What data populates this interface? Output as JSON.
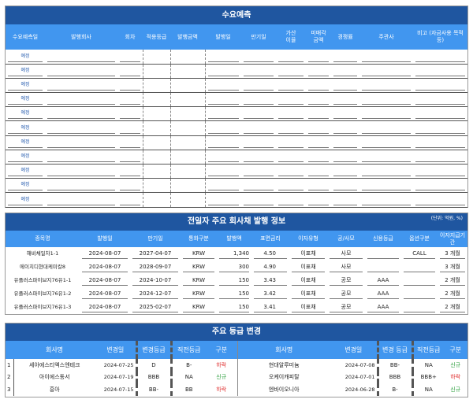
{
  "forecast": {
    "title": "수요예측",
    "headers": [
      "수요예측일",
      "발행회사",
      "회차",
      "적용등급",
      "발행금액",
      "발행일",
      "만기일",
      "가산\n이율",
      "미매각\n금액",
      "경쟁률",
      "주관사",
      "비고 (자금사용 목적 등)"
    ],
    "rows": [
      "예정",
      "예정",
      "예정",
      "예정",
      "예정",
      "예정",
      "예정",
      "예정",
      "예정",
      "예정",
      "예정"
    ]
  },
  "issuance": {
    "title": "전일자 주요 회사채 발행 정보",
    "unit": "(단위: 억원, %)",
    "headers": [
      "종목명",
      "발행일",
      "만기일",
      "통화구분",
      "발행액",
      "표면금리",
      "이자유형",
      "공/사모",
      "신용등급",
      "옵션구분",
      "이자지급기간"
    ],
    "rows": [
      [
        "해비채일차1-1",
        "2024-08-07",
        "2027-04-07",
        "KRW",
        "1,340",
        "4.50",
        "이표채",
        "사모",
        "",
        "CALL",
        "3 개월"
      ],
      [
        "에이치디현대케미칼8",
        "2024-08-07",
        "2028-09-07",
        "KRW",
        "300",
        "4.90",
        "이표채",
        "사모",
        "",
        "",
        "3 개월"
      ],
      [
        "유플러스파이브지76유1-1",
        "2024-08-07",
        "2024-10-07",
        "KRW",
        "150",
        "3.43",
        "이표채",
        "공모",
        "AAA",
        "",
        "2 개월"
      ],
      [
        "유플러스파이브지76유1-2",
        "2024-08-07",
        "2024-12-07",
        "KRW",
        "150",
        "3.42",
        "이표채",
        "공모",
        "AAA",
        "",
        "2 개월"
      ],
      [
        "유플러스파이브지76유1-3",
        "2024-08-07",
        "2025-02-07",
        "KRW",
        "150",
        "3.41",
        "이표채",
        "공모",
        "AAA",
        "",
        "2 개월"
      ]
    ]
  },
  "ratings": {
    "title": "주요 등급 변경",
    "headers_left": [
      "회사명",
      "변경일",
      "변경등급",
      "직전등급",
      "구분"
    ],
    "headers_right": [
      "회사명",
      "변경일",
      "변경 등급",
      "직전등급",
      "구분"
    ],
    "rows": [
      {
        "idx": "1",
        "l": [
          "세아에스티엑스엔테크",
          "2024-07-25",
          "D",
          "B-",
          "하락"
        ],
        "r": [
          "현대알루미늄",
          "2024-07-08",
          "BB-",
          "NA",
          "신규"
        ]
      },
      {
        "idx": "2",
        "l": [
          "아이에스동서",
          "2024-07-19",
          "BBB",
          "NA",
          "신규"
        ],
        "r": [
          "오케이캐피탈",
          "2024-07-01",
          "BBB",
          "BBB+",
          "하락"
        ]
      },
      {
        "idx": "3",
        "l": [
          "흥아",
          "2024-07-15",
          "BB-",
          "BB",
          "하락"
        ],
        "r": [
          "엔바이오니아",
          "2024-06-28",
          "B-",
          "NA",
          "신규"
        ]
      }
    ]
  },
  "colors": {
    "title_bg": "#1f56a0",
    "header_bg": "#4196ef",
    "down": "#e03030",
    "new": "#2fa040"
  }
}
